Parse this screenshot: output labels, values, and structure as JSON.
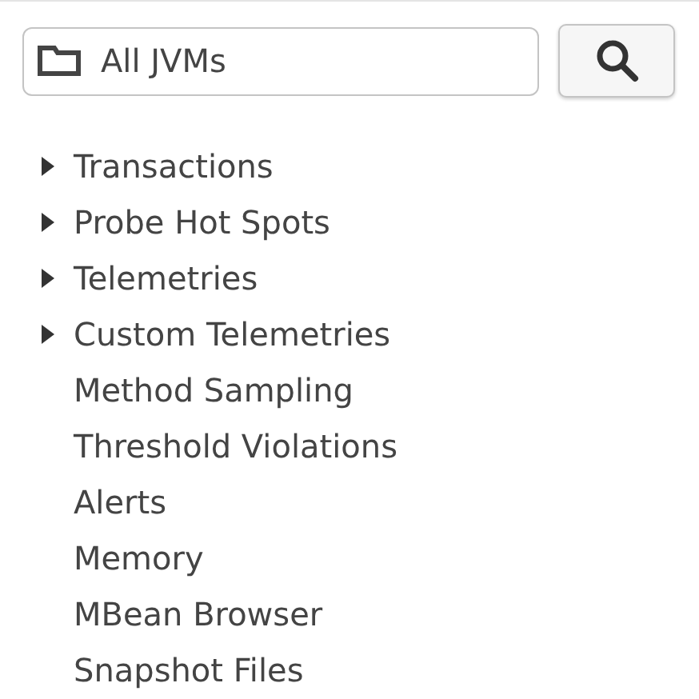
{
  "scope_field": {
    "value": "All JVMs"
  },
  "tree": [
    {
      "label": "Transactions",
      "kind": "group",
      "expanded": false
    },
    {
      "label": "Probe Hot Spots",
      "kind": "group",
      "expanded": false
    },
    {
      "label": "Telemetries",
      "kind": "group",
      "expanded": false
    },
    {
      "label": "Custom Telemetries",
      "kind": "group",
      "expanded": false
    },
    {
      "label": "Method Sampling",
      "kind": "leaf"
    },
    {
      "label": "Threshold Violations",
      "kind": "leaf"
    },
    {
      "label": "Alerts",
      "kind": "leaf"
    },
    {
      "label": "Memory",
      "kind": "leaf"
    },
    {
      "label": "MBean Browser",
      "kind": "leaf"
    },
    {
      "label": "Snapshot Files",
      "kind": "leaf"
    }
  ]
}
